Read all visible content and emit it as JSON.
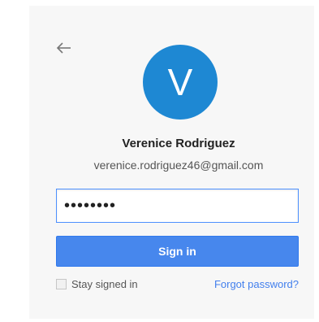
{
  "account": {
    "avatar_letter": "V",
    "avatar_color": "#1e88d3",
    "name": "Verenice Rodriguez",
    "email": "verenice.rodriguez46@gmail.com"
  },
  "form": {
    "password_value": "••••••••",
    "signin_label": "Sign in",
    "stay_signed_in_label": "Stay signed in",
    "stay_signed_in_checked": false,
    "forgot_password_label": "Forgot password?"
  },
  "icons": {
    "back": "back-arrow-icon"
  },
  "colors": {
    "button": "#4787ed",
    "link": "#427fed",
    "card_background": "#f7f7f7"
  }
}
